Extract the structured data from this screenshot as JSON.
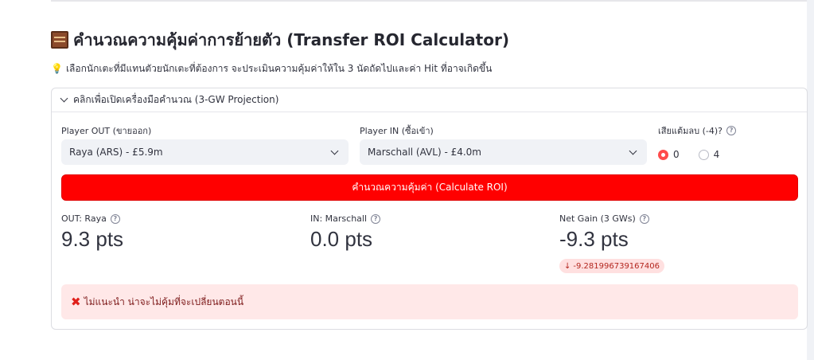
{
  "page": {
    "title": "คำนวณความคุ้มค่าการย้ายตัว (Transfer ROI Calculator)",
    "title_icon": "abacus-icon",
    "subtitle": "เลือกนักเตะที่มีแทนตัวยนักเตะที่ต้องการ จะประเมินความคุ้มค่าให้ใน 3 นัดถัดไปและค่า Hit ที่อาจเกิดขึ้น",
    "subtitle_icon": "lightbulb-icon"
  },
  "expander": {
    "label": "คลิกเพื่อเปิดเครื่องมือคำนวณ (3-GW Projection)",
    "expanded": true
  },
  "form": {
    "player_out": {
      "label": "Player OUT (ขายออก)",
      "value": "Raya (ARS) - £5.9m"
    },
    "player_in": {
      "label": "Player IN (ซื้อเข้า)",
      "value": "Marschall (AVL) - £4.0m"
    },
    "hit": {
      "label": "เสียแต้มลบ (-4)?",
      "options": [
        "0",
        "4"
      ],
      "selected": "0"
    },
    "calculate_label": "คำนวณความคุ้มค่า (Calculate ROI)"
  },
  "metrics": [
    {
      "label": "OUT: Raya",
      "value": "9.3 pts"
    },
    {
      "label": "IN: Marschall",
      "value": "0.0 pts"
    },
    {
      "label": "Net Gain (3 GWs)",
      "value": "-9.3 pts",
      "delta": "-9.281996739167406"
    }
  ],
  "alert": {
    "text": "ไม่แนะนำ น่าจะไม่คุ้มที่จะเปลี่ยนตอนนี้",
    "icon": "cross-mark-icon"
  },
  "colors": {
    "primary_button": "#ff0000",
    "radio_accent": "#ff4b4b",
    "alert_bg": "#ffe8e8",
    "delta_bg": "#ffe0e0"
  }
}
